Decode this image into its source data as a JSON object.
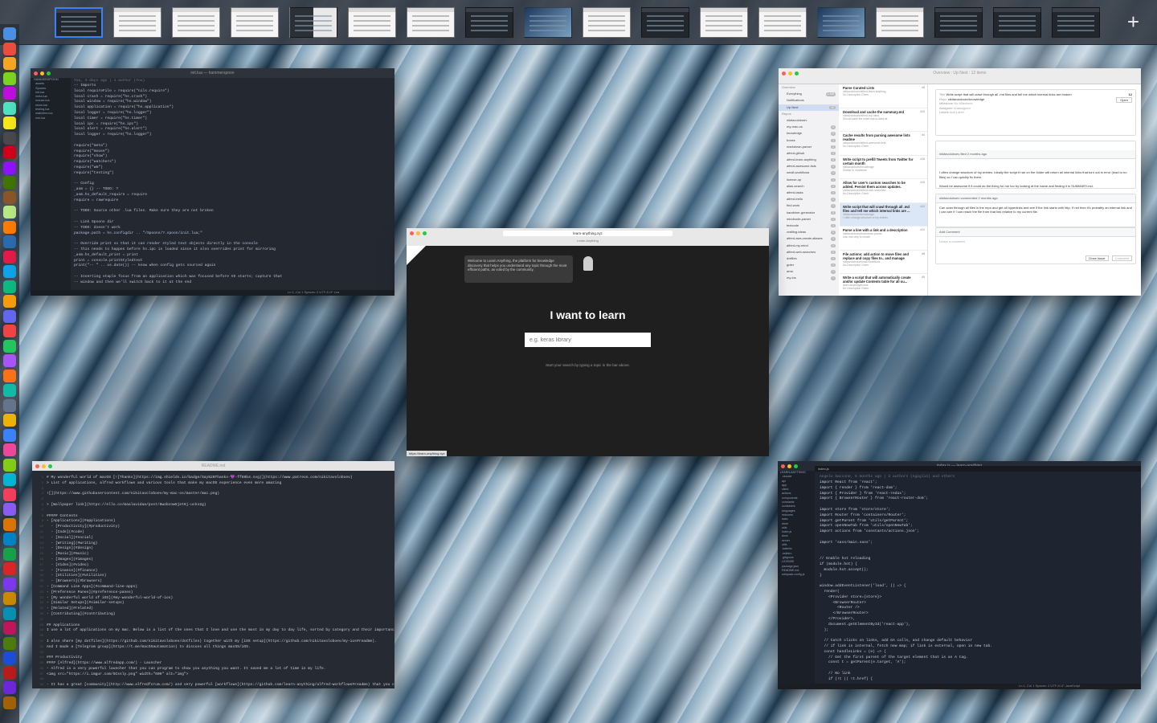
{
  "spaces_bar": {
    "thumbnails": [
      {
        "kind": "dark",
        "active": true
      },
      {
        "kind": "light"
      },
      {
        "kind": "light"
      },
      {
        "kind": "light"
      },
      {
        "kind": "mixed"
      },
      {
        "kind": "light"
      },
      {
        "kind": "light"
      },
      {
        "kind": "dark"
      },
      {
        "kind": "blue"
      },
      {
        "kind": "light"
      },
      {
        "kind": "dark"
      },
      {
        "kind": "light"
      },
      {
        "kind": "light"
      },
      {
        "kind": "blue"
      },
      {
        "kind": "light"
      },
      {
        "kind": "dark"
      },
      {
        "kind": "dark"
      },
      {
        "kind": "dark"
      }
    ],
    "add_label": "+"
  },
  "dock": {
    "icon_colors": [
      "#4a90e2",
      "#e94e3c",
      "#f5a623",
      "#7ed321",
      "#bd10e0",
      "#50e3c2",
      "#f8e71c",
      "#4a4a4a",
      "#d0021b",
      "#9013fe",
      "#417505",
      "#8b572a",
      "#b8e986",
      "#ff7b00",
      "#2b6cb0",
      "#e11d48",
      "#0ea5e9",
      "#10b981",
      "#f59e0b",
      "#6366f1",
      "#ef4444",
      "#22c55e",
      "#a855f7",
      "#f97316",
      "#14b8a6",
      "#64748b",
      "#eab308",
      "#3b82f6",
      "#ec4899",
      "#84cc16",
      "#06b6d4",
      "#f43f5e",
      "#8b5cf6",
      "#d97706",
      "#0284c7",
      "#16a34a",
      "#dc2626",
      "#7c3aed",
      "#ca8a04",
      "#0891b2",
      "#be185d",
      "#4d7c0f",
      "#1d4ed8",
      "#b91c1c",
      "#6d28d9",
      "#a16207"
    ]
  },
  "hammerspoon": {
    "title": "init.lua — hammerspoon",
    "blame": "You, 3 days ago | 1 author (You)",
    "code": "-- Imports\nlocal requireFile = require(\"nils.require\")\nlocal crash = require(\"hs.crash\")\nlocal window = require(\"hs.window\")\nlocal application = require(\"hs.application\")\nlocal logger = require(\"hs.logger\")\nlocal timer = require(\"hs.timer\")\nlocal ipc = require(\"hs.ipc\")\nlocal alert = require(\"hs.alert\")\nlocal logger = require(\"hs.logger\")\n\nrequire(\"meta\")\nrequire(\"mouse\")\nrequire(\"show\")\nrequire(\"watchers\")\nrequire(\"wm\")\nrequire(\"testing\")\n\n-- Config\n_asm = {} -- TODO: ?\n_asm.hs_default_require = require\nrequire = rawrequire\n\n-- TODO: Source other .lua files. Make sure they are not broken\n\n-- Link Spoons dir\n-- TODO: doesn't work\npackage.path = hs.configdir .. \"/Spoons/?.spoon/init.lua;\"\n\n-- Override print so that it can render styled text objects directly in the console\n-- this needs to happen before hs.ipc is loaded since it also overrides print for mirroring\n_asm.hs_default_print = print\nprint = console.printStyledtext\nprint(\"-- \" .. os.date()) -- know when config gets sourced again\n\n-- Inverting staple focus from an application which was focused before VS starts; capture that\n-- window and then we'll switch back to it at the end",
    "tree": "HAMMERSPOON\n  assets\n  Spoons\n  init.lua\n  meta.lua\n  mouse.lua\n  show.lua\n  testing.lua\n  watchers.lua\n  wm.lua",
    "status": "Ln 1, Col 1  Spaces: 2  UTF-8  LF  Lua"
  },
  "learn_anything": {
    "url": "learn-anything.xyz",
    "tab_title": "Learn Anything",
    "notice": "Welcome to Learn Anything, the platform for knowledge discovery that helps you understand any topic through the most efficient paths, as voted by the community.",
    "heading": "I want to learn",
    "search_placeholder": "e.g. keras library",
    "hint": "Start your search by typing a topic in the bar above.",
    "status_url": "https://learn-anything.xyz"
  },
  "github_issues": {
    "title": "Overview : Up Next : 12 items",
    "nav_sections": [
      {
        "label": "Overview",
        "header": true
      },
      {
        "label": "Everything",
        "count": "1,445"
      },
      {
        "label": "Notifications"
      },
      {
        "label": "Up Next",
        "count": "12",
        "selected": true
      },
      {
        "label": "Repos",
        "header": true
      },
      {
        "label": "nikitavoloboev",
        "count": ""
      },
      {
        "label": "my-mac-os",
        "count": "4"
      },
      {
        "label": "knowledge",
        "count": "3"
      },
      {
        "label": "boxes",
        "count": "1"
      },
      {
        "label": "markdown-parser",
        "count": "2"
      },
      {
        "label": "alfred-github",
        "count": "1"
      },
      {
        "label": "alfred-learn-anything",
        "count": "5"
      },
      {
        "label": "alfred-awesome-lists",
        "count": "2"
      },
      {
        "label": "small-workflows",
        "count": "1"
      },
      {
        "label": "license-up",
        "count": "1"
      },
      {
        "label": "alias-search",
        "count": "2"
      },
      {
        "label": "alfred-tasks",
        "count": "1"
      },
      {
        "label": "alfred-trello",
        "count": "1"
      },
      {
        "label": "find-work",
        "count": "1"
      },
      {
        "label": "karabiner-generator",
        "count": "3"
      },
      {
        "label": "mindnode-parser",
        "count": "1"
      },
      {
        "label": "textcode",
        "count": "1"
      },
      {
        "label": "crafting-ideas",
        "count": "2"
      },
      {
        "label": "alfred-aws-create-aliases",
        "count": "1"
      },
      {
        "label": "alfred-my-mind",
        "count": "1"
      },
      {
        "label": "alfred-web-searches",
        "count": "2"
      },
      {
        "label": "dotfiles",
        "count": "1"
      },
      {
        "label": "guter",
        "count": "1"
      },
      {
        "label": "ama",
        "count": "1"
      },
      {
        "label": "my-ios",
        "count": "1"
      }
    ],
    "issues": [
      {
        "title": "Parse Curated Lists",
        "num": "#8",
        "repo": "nikitavoloboev/alfred-learn-anything",
        "meta": "No Description Given"
      },
      {
        "title": "Download and cache the summary.md",
        "num": "#10",
        "repo": "nikitavoloboev/alfred-my-mind",
        "meta": "Should save the index.sqs to data dir"
      },
      {
        "title": "Cache results from parsing awesome lists readme",
        "num": "#4",
        "repo": "nikitavoloboev/alfred-awesome-lists",
        "meta": "No Description Given"
      },
      {
        "title": "Write script to prefill Tweets from Twitter for certain month",
        "num": "#16",
        "repo": "nikitavoloboev/knowledge",
        "meta": "Similar to /mu/ideas"
      },
      {
        "title": "Allow for user's custom searches to be added. Persist them across updates.",
        "num": "#15",
        "repo": "nikitavoloboev/alfred-web-searches",
        "meta": "No Description Given"
      },
      {
        "title": "Write script that will crawl through all .md files and tell me which internal links are ...",
        "num": "#12",
        "repo": "nikitavoloboev/knowledge",
        "meta": "I often change structure of my entries"
      },
      {
        "title": "Parse a line with a link and a description",
        "num": "#12",
        "repo": "nikitavoloboev/markdown-parser",
        "meta": "Use rust only to create"
      },
      {
        "title": "File actions: add action to move files and replace and copy files to.. and manage",
        "num": "#8",
        "repo": "nikitavoloboev/small-workflows",
        "meta": "No Description Given"
      },
      {
        "title": "Write a script that will automatically create and/or update Contents table for all ou...",
        "num": "#5",
        "repo": "learn-anything/books",
        "meta": "No Description Given"
      }
    ],
    "detail": {
      "title_label": "Title",
      "title_value": "Write script that will crawl through all .md files and tell me which internal links are broken",
      "num": "12",
      "repo_label": "Repo",
      "repo_value": "nikitavoloboev/knowledge",
      "state": "Open",
      "milestone_label": "Milestone",
      "milestone_value": "No Milestone",
      "assignee_label": "Assignee",
      "assignee_value": "Unassigned",
      "labels_label": "Labels",
      "labels_value": "Add Label",
      "comment1_head": "nikitavoloboev filed 2 months ago",
      "comment1_body": "I often change structure of my entries. Ideally the script if ran on the folder will return all internal links that turn out in error (lead to no files) so I can quickly fix them.\n\nWould be awesome if it could do the fixing for me too by looking at the name and finding it in SUMMARY.md.",
      "comment2_head": "nikitavoloboev commented 2 months ago",
      "comment2_body": "Can scan through all files in the repo and get all hyperlinks and see if the link starts with http. If not then it's probably an internal link and I can see if I can reach the file from that link relative to my current file.",
      "add_comment": "Add Comment",
      "leave_comment": "Leave a comment",
      "close_button": "Close Issue",
      "comment_button": "Comment"
    }
  },
  "readme": {
    "title": "README.md",
    "code": "# My wonderful world of macOS [![Thanks](https://img.shields.io/badge/Say%20Thanks-💜-ff69b4.svg)](https://www.patreon.com/nikitavoloboev)\n> List of applications, alfred workflows and various tools that make my macOS experience even more amazing\n\n![](https://www.githubusercontent.com/nikitavoloboev/my-mac-os/master/mac.png)\n\n> [Wallpaper link](https://ello.co/maalavidaa/post/8wsbcnw5jet6j-ucks2g)\n\n##### Contents\n- [Applications](#applications)\n  - [Productivity](#productivity)\n  - [Code](#code)\n  - [Social](#social)\n  - [Writing](#writing)\n  - [Design](#design)\n  - [Music](#music)\n  - [Images](#images)\n  - [Video](#video)\n  - [Finance](#finance)\n  - [Utilities](#utilities)\n  - [Browsers](#browsers)\n- [Command Line Apps](#command-line-apps)\n- [Preference Panes](#preference-panes)\n- [My wonderful world of iOS](#my-wonderful-world-of-ios)\n- [Similar Setups](#similar-setups)\n- [Related](#related)\n- [Contributing](#contributing)\n\n## Applications\nI use a lot of applications on my mac. Below is a list of the ones that I love and use the most in my day to day life, sorted by category and their importance.\n\nI also share [my dotfiles](https://github.com/nikitavoloboev/dotfiles) together with my [iOS setup](https://github.com/nikitavoloboev/my-ios#readme).\nAnd I made a [Telegram group](https://t.me/macOSautomation) to discuss all things macOS/iOS.\n\n### Productivity\n#### [Alfred](https://www.alfredapp.com/) - Launcher\n- Alfred is a very powerful launcher that you can program to show you anything you want. It saved me a lot of time in my life.\n<img src=\"https://i.imgur.com/5Cssly.png\" width=\"600\" alt=\"img\">\n\n- It has a great [community](http://www.alfredforum.com/) and very powerful [workflows](https://github.com/learn-anything/alfred-workflows#readme) that you can use.\n\n- I wrote [an article](https://medium.com/@NikitaVoloboev/writing-alfred-workflows-in-go-2a44f62dc432) on how anyone can start developing workflows of their own using Go language and [AwGo](https://github.com/deanishe/awgo) library."
  },
  "vscode": {
    "title": "index.js — learn-anything",
    "tab": "index.js",
    "blame": "Angelo Saccone, 6 months ago | 2 authors (sgiglio) and others",
    "tree": "LEARN-ANYTHING\n  .vscode\n  api\n  app\n  client\n  actions\n  components\n  constants\n  containers\n  languages\n  reducers\n  sass\n  store\n  utils\n  index.js\n  docs\n  server\n  utils\n  .babelrc\n  .eslintrc\n  .gitignore\n  LICENSE\n  package.json\n  README.md\n  webpack.config.js",
    "code": "import React from 'react';\nimport { render } from 'react-dom';\nimport { Provider } from 'react-redux';\nimport { BrowserRouter } from 'react-router-dom';\n\nimport store from 'store/store';\nimport Router from 'containers/Router';\nimport getParent from 'utils/getParent';\nimport openNewTab from 'utils/openNewTab';\nimport actions from 'constants/actions.json';\n\nimport 'sass/main.sass';\n\n\n// Enable hot reloading\nif (module.hot) {\n  module.hot.accept();\n}\n\nwindow.addEventListener('load', () => {\n  render(\n    <Provider store={store}>\n      <BrowserRouter>\n        <Router />\n      </BrowserRouter>\n    </Provider>,\n    document.getElementById('react-app'),\n  );\n\n  // Catch clicks on links, add GA calls, and change default behavior\n  // if link is internal, fetch new map; if link is external, open in new tab.\n  const handleLinks = (e) => {\n    // Get the first parent of the target element that is an A tag.\n    const t = getParent(e.target, 'A');\n\n    // No link\n    if (!t || !t.href) {",
    "status": "Ln 1, Col 1  Spaces: 2  UTF-8  LF  JavaScript"
  }
}
